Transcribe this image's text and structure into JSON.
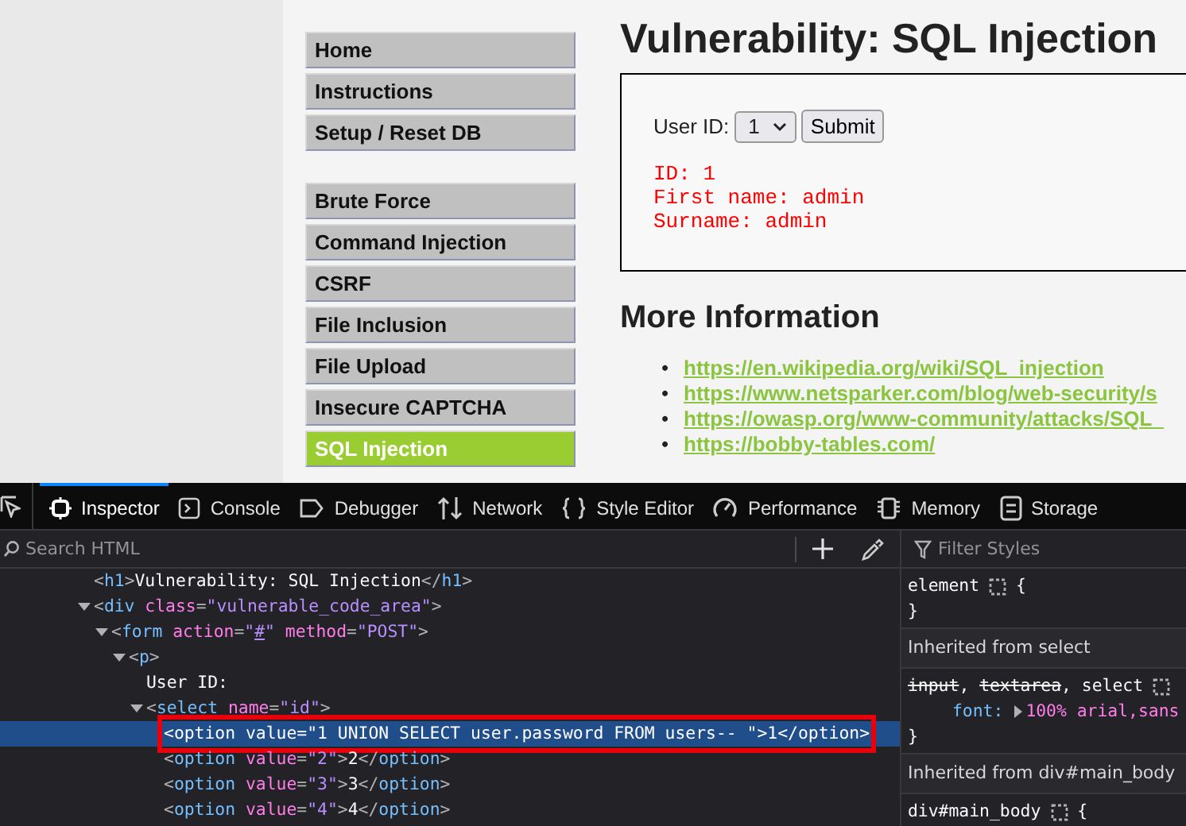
{
  "menu": {
    "groups": [
      {
        "items": [
          {
            "label": "Home",
            "selected": false
          },
          {
            "label": "Instructions",
            "selected": false
          },
          {
            "label": "Setup / Reset DB",
            "selected": false
          }
        ]
      },
      {
        "items": [
          {
            "label": "Brute Force",
            "selected": false
          },
          {
            "label": "Command Injection",
            "selected": false
          },
          {
            "label": "CSRF",
            "selected": false
          },
          {
            "label": "File Inclusion",
            "selected": false
          },
          {
            "label": "File Upload",
            "selected": false
          },
          {
            "label": "Insecure CAPTCHA",
            "selected": false
          },
          {
            "label": "SQL Injection",
            "selected": true
          }
        ]
      }
    ]
  },
  "main": {
    "title": "Vulnerability: SQL Injection",
    "form": {
      "label": "User ID:",
      "select_value": "1",
      "submit": "Submit",
      "result_lines": [
        "ID: 1",
        "First name: admin",
        "Surname: admin"
      ]
    },
    "more_info": {
      "title": "More Information",
      "links": [
        {
          "marker": "•",
          "text": "https://en.wikipedia.org/wiki/SQL_injection"
        },
        {
          "marker": "•",
          "text": "https://www.netsparker.com/blog/web-security/s"
        },
        {
          "marker": "•",
          "text": "https://owasp.org/www-community/attacks/SQL_"
        },
        {
          "marker": "•",
          "text": "https://bobby-tables.com/"
        }
      ]
    }
  },
  "devtools": {
    "tabs": [
      {
        "label": "Inspector",
        "selected": true
      },
      {
        "label": "Console",
        "selected": false
      },
      {
        "label": "Debugger",
        "selected": false
      },
      {
        "label": "Network",
        "selected": false
      },
      {
        "label": "Style Editor",
        "selected": false
      },
      {
        "label": "Performance",
        "selected": false
      },
      {
        "label": "Memory",
        "selected": false
      },
      {
        "label": "Storage",
        "selected": false
      }
    ],
    "search": {
      "placeholder": "Search HTML"
    },
    "markup": [
      {
        "selected": false,
        "outlined": false,
        "tokens": [
          {
            "kind": "punct",
            "text": "<"
          },
          {
            "kind": "tag",
            "text": "h1"
          },
          {
            "kind": "punct",
            "text": ">"
          },
          {
            "kind": "text",
            "text": "Vulnerability: SQL Injection"
          },
          {
            "kind": "punct",
            "text": "</"
          },
          {
            "kind": "tag",
            "text": "h1"
          },
          {
            "kind": "punct",
            "text": ">"
          }
        ]
      },
      {
        "selected": false,
        "outlined": false,
        "expanded": true,
        "tokens": [
          {
            "kind": "punct",
            "text": "<"
          },
          {
            "kind": "tag",
            "text": "div"
          },
          {
            "kind": "attr",
            "text": "class"
          },
          {
            "kind": "punct",
            "text": "="
          },
          {
            "kind": "value",
            "text": "\"vulnerable_code_area\""
          },
          {
            "kind": "punct",
            "text": ">"
          }
        ],
        "children": [
          {
            "selected": false,
            "outlined": false,
            "expanded": true,
            "tokens": [
              {
                "kind": "punct",
                "text": "<"
              },
              {
                "kind": "tag",
                "text": "form"
              },
              {
                "kind": "attr",
                "text": "action"
              },
              {
                "kind": "punct",
                "text": "="
              },
              {
                "kind": "value",
                "text": "\""
              },
              {
                "kind": "link",
                "text": "#"
              },
              {
                "kind": "value",
                "text": "\""
              },
              {
                "kind": "attr",
                "text": "method"
              },
              {
                "kind": "punct",
                "text": "="
              },
              {
                "kind": "value",
                "text": "\"POST\""
              },
              {
                "kind": "punct",
                "text": ">"
              }
            ],
            "children": [
              {
                "selected": false,
                "outlined": false,
                "expanded": true,
                "tokens": [
                  {
                    "kind": "punct",
                    "text": "<"
                  },
                  {
                    "kind": "tag",
                    "text": "p"
                  },
                  {
                    "kind": "punct",
                    "text": ">"
                  }
                ],
                "children": [
                  {
                    "selected": false,
                    "outlined": false,
                    "tokens": [
                      {
                        "kind": "text",
                        "text": "User ID:"
                      }
                    ]
                  },
                  {
                    "selected": false,
                    "outlined": false,
                    "expanded": true,
                    "tokens": [
                      {
                        "kind": "punct",
                        "text": "<"
                      },
                      {
                        "kind": "tag",
                        "text": "select"
                      },
                      {
                        "kind": "attr",
                        "text": "name"
                      },
                      {
                        "kind": "punct",
                        "text": "="
                      },
                      {
                        "kind": "value",
                        "text": "\"id\""
                      },
                      {
                        "kind": "punct",
                        "text": ">"
                      }
                    ],
                    "children": [
                      {
                        "selected": true,
                        "outlined": true,
                        "tokens": [
                          {
                            "kind": "punct",
                            "text": "<"
                          },
                          {
                            "kind": "tag",
                            "text": "option"
                          },
                          {
                            "kind": "attr",
                            "text": "value"
                          },
                          {
                            "kind": "punct",
                            "text": "="
                          },
                          {
                            "kind": "value",
                            "text": "\"1 UNION SELECT user.password FROM users-- \""
                          },
                          {
                            "kind": "punct",
                            "text": ">"
                          },
                          {
                            "kind": "text",
                            "text": "1"
                          },
                          {
                            "kind": "punct",
                            "text": "</"
                          },
                          {
                            "kind": "tag",
                            "text": "option"
                          },
                          {
                            "kind": "punct",
                            "text": ">"
                          }
                        ]
                      },
                      {
                        "selected": false,
                        "outlined": false,
                        "tokens": [
                          {
                            "kind": "punct",
                            "text": "<"
                          },
                          {
                            "kind": "tag",
                            "text": "option"
                          },
                          {
                            "kind": "attr",
                            "text": "value"
                          },
                          {
                            "kind": "punct",
                            "text": "="
                          },
                          {
                            "kind": "value",
                            "text": "\"2\""
                          },
                          {
                            "kind": "punct",
                            "text": ">"
                          },
                          {
                            "kind": "text",
                            "text": "2"
                          },
                          {
                            "kind": "punct",
                            "text": "</"
                          },
                          {
                            "kind": "tag",
                            "text": "option"
                          },
                          {
                            "kind": "punct",
                            "text": ">"
                          }
                        ]
                      },
                      {
                        "selected": false,
                        "outlined": false,
                        "tokens": [
                          {
                            "kind": "punct",
                            "text": "<"
                          },
                          {
                            "kind": "tag",
                            "text": "option"
                          },
                          {
                            "kind": "attr",
                            "text": "value"
                          },
                          {
                            "kind": "punct",
                            "text": "="
                          },
                          {
                            "kind": "value",
                            "text": "\"3\""
                          },
                          {
                            "kind": "punct",
                            "text": ">"
                          },
                          {
                            "kind": "text",
                            "text": "3"
                          },
                          {
                            "kind": "punct",
                            "text": "</"
                          },
                          {
                            "kind": "tag",
                            "text": "option"
                          },
                          {
                            "kind": "punct",
                            "text": ">"
                          }
                        ]
                      },
                      {
                        "selected": false,
                        "outlined": false,
                        "tokens": [
                          {
                            "kind": "punct",
                            "text": "<"
                          },
                          {
                            "kind": "tag",
                            "text": "option"
                          },
                          {
                            "kind": "attr",
                            "text": "value"
                          },
                          {
                            "kind": "punct",
                            "text": "="
                          },
                          {
                            "kind": "value",
                            "text": "\"4\""
                          },
                          {
                            "kind": "punct",
                            "text": ">"
                          },
                          {
                            "kind": "text",
                            "text": "4"
                          },
                          {
                            "kind": "punct",
                            "text": "</"
                          },
                          {
                            "kind": "tag",
                            "text": "option"
                          },
                          {
                            "kind": "punct",
                            "text": ">"
                          }
                        ]
                      }
                    ]
                  }
                ]
              }
            ]
          }
        ]
      }
    ],
    "rules": {
      "filter": {
        "placeholder": "Filter Styles"
      },
      "sections": [
        {
          "kind": "rule",
          "selectors": [
            {
              "text": "element",
              "overridden": false
            }
          ],
          "open": "{",
          "close": "}"
        },
        {
          "kind": "header",
          "text": "Inherited from select"
        },
        {
          "kind": "rule",
          "selectors": [
            {
              "text": "input",
              "overridden": true,
              "separator": ","
            },
            {
              "text": "textarea",
              "overridden": true,
              "separator": ","
            },
            {
              "text": "select",
              "overridden": false
            }
          ],
          "declarations": [
            {
              "property": "font:",
              "value": "100% arial,sans"
            }
          ],
          "close": "}"
        },
        {
          "kind": "header",
          "text": "Inherited from div#main_body"
        },
        {
          "kind": "rule",
          "selectors": [
            {
              "text": "div#main_body",
              "overridden": false
            }
          ],
          "open": "{"
        }
      ]
    }
  }
}
